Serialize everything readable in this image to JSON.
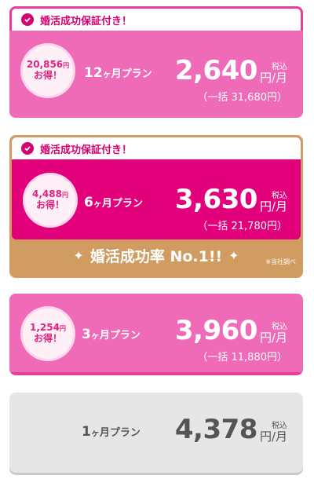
{
  "guarantee_label": "婚活成功保証付き！",
  "plans": [
    {
      "discount": "20,856",
      "yen": "円",
      "gain": "お得！",
      "months": "12",
      "ke": "ヶ",
      "plan_suffix": "月プラン",
      "price": "2,640",
      "tax": "税込",
      "per": "円/月",
      "lump": "（一括 31,680円）"
    },
    {
      "discount": "4,488",
      "yen": "円",
      "gain": "お得！",
      "months": "6",
      "ke": "ヶ",
      "plan_suffix": "月プラン",
      "price": "3,630",
      "tax": "税込",
      "per": "円/月",
      "lump": "（一括 21,780円）"
    },
    {
      "discount": "1,254",
      "yen": "円",
      "gain": "お得！",
      "months": "3",
      "ke": "ヶ",
      "plan_suffix": "月プラン",
      "price": "3,960",
      "tax": "税込",
      "per": "円/月",
      "lump": "（一括 11,880円）"
    },
    {
      "months": "1",
      "ke": "ヶ",
      "plan_suffix": "月プラン",
      "price": "4,378",
      "tax": "税込",
      "per": "円/月"
    }
  ],
  "success_rate": {
    "text": "婚活成功率 No.1!!",
    "note": "※当社調べ",
    "sparkle": "✦"
  },
  "colors": {
    "pink": "#ef6bb8",
    "magenta": "#e3007b",
    "gold": "#d19c62",
    "gray": "#e6e6e6"
  }
}
